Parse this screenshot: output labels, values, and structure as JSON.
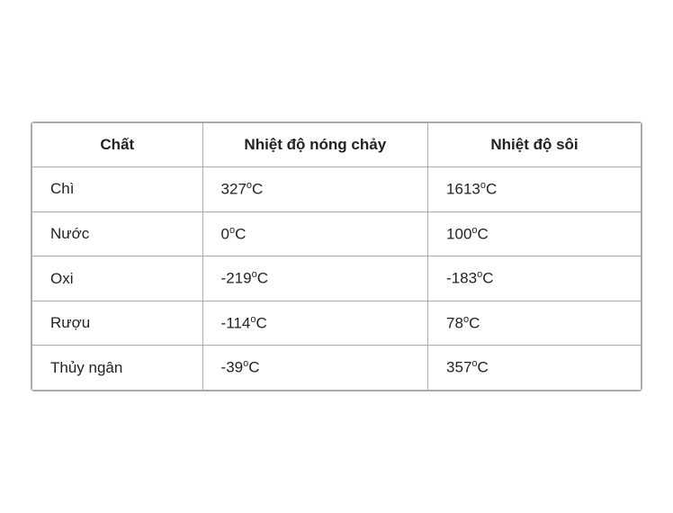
{
  "table": {
    "headers": {
      "col1": "Chất",
      "col2": "Nhiệt độ nóng chảy",
      "col3": "Nhiệt độ sôi"
    },
    "rows": [
      {
        "chat": "Chì",
        "nong_chay_num": "327",
        "nong_chay_unit": "°C",
        "soi_num": "1613",
        "soi_unit": "°C"
      },
      {
        "chat": "Nước",
        "nong_chay_num": "0",
        "nong_chay_unit": "°C",
        "soi_num": "100",
        "soi_unit": "°C"
      },
      {
        "chat": "Oxi",
        "nong_chay_num": "-219",
        "nong_chay_unit": "°C",
        "soi_num": "-183",
        "soi_unit": "°C"
      },
      {
        "chat": "Rượu",
        "nong_chay_num": "-114",
        "nong_chay_unit": "°C",
        "soi_num": "78",
        "soi_unit": "°C"
      },
      {
        "chat": "Thủy ngân",
        "nong_chay_num": "-39",
        "nong_chay_unit": "°C",
        "soi_num": "357",
        "soi_unit": "°C"
      }
    ]
  }
}
